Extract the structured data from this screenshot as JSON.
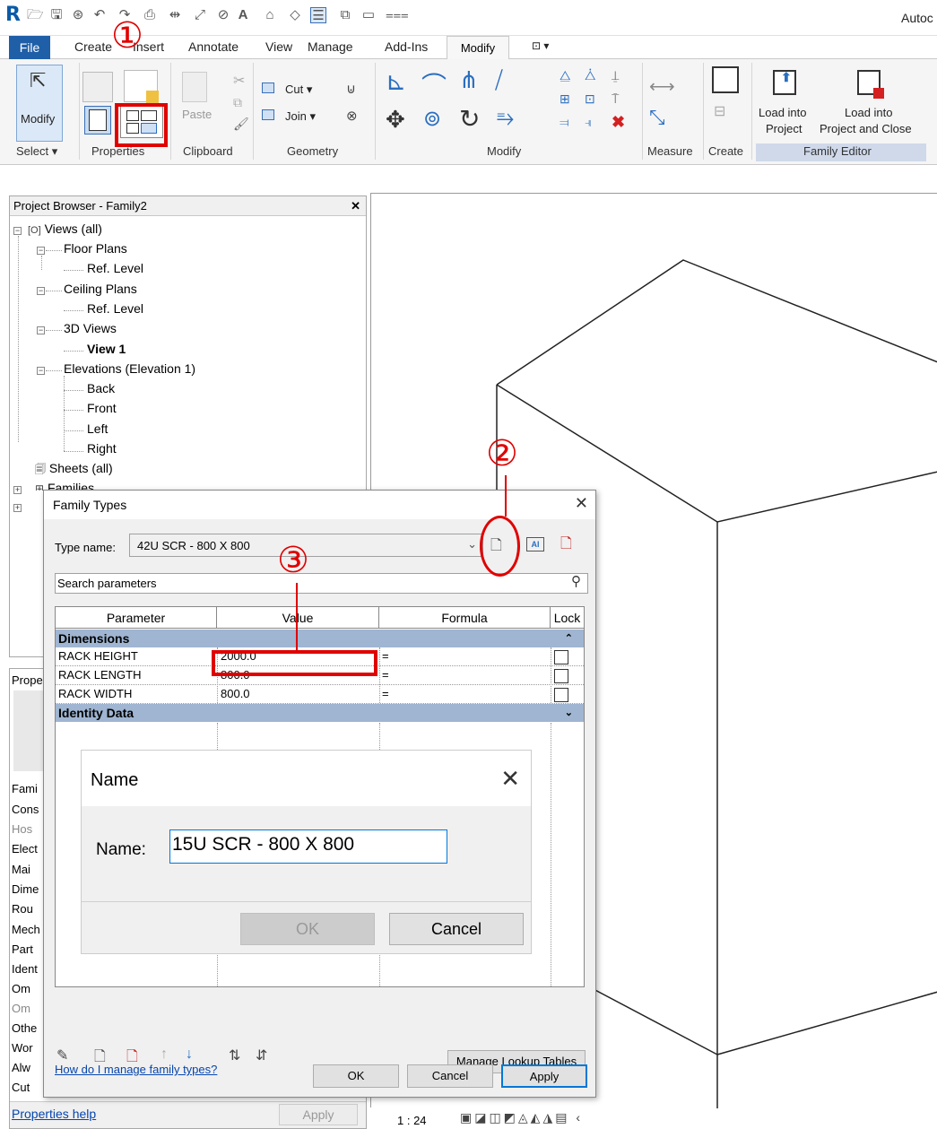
{
  "app": {
    "title": "Autoc"
  },
  "tabs": [
    {
      "label": "File"
    },
    {
      "label": "Create"
    },
    {
      "label": "Insert"
    },
    {
      "label": "Annotate"
    },
    {
      "label": "View"
    },
    {
      "label": "Manage"
    },
    {
      "label": "Add-Ins"
    },
    {
      "label": "Modify"
    },
    {
      "label": "⊡ ▾"
    }
  ],
  "ribbon": {
    "modify_label": "Modify",
    "paste_label": "Paste",
    "cut_label": "Cut ▾",
    "join_label": "Join ▾",
    "load_into_project_1": "Load into",
    "load_into_project_2": "Project",
    "load_close_1": "Load into",
    "load_close_2": "Project and Close",
    "panels": {
      "select": "Select ▾",
      "properties": "Properties",
      "clipboard": "Clipboard",
      "geometry": "Geometry",
      "modify": "Modify",
      "measure": "Measure",
      "create": "Create",
      "family_editor": "Family Editor"
    }
  },
  "project_browser": {
    "title": "Project Browser - Family2",
    "items": [
      {
        "label": "Views (all)"
      },
      {
        "label": "Floor Plans"
      },
      {
        "label": "Ref. Level"
      },
      {
        "label": "Ceiling Plans"
      },
      {
        "label": "Ref. Level"
      },
      {
        "label": "3D Views"
      },
      {
        "label": "View 1"
      },
      {
        "label": "Elevations (Elevation 1)"
      },
      {
        "label": "Back"
      },
      {
        "label": "Front"
      },
      {
        "label": "Left"
      },
      {
        "label": "Right"
      },
      {
        "label": "Sheets (all)"
      },
      {
        "label": "Families"
      }
    ]
  },
  "properties_palette": {
    "title": "Prope",
    "rows": [
      "Fami",
      "Cons",
      "Hos",
      "Elect",
      "Mai",
      "Dime",
      "Rou",
      "Mech",
      "Part",
      "Ident",
      "Om",
      "Om",
      "Othe",
      "Wor",
      "Alw",
      "Cut"
    ],
    "help_link": "Properties help",
    "apply": "Apply"
  },
  "family_types": {
    "title": "Family Types",
    "type_name_label": "Type name:",
    "type_name_value": "42U SCR - 800 X 800",
    "search_placeholder": "Search parameters",
    "columns": {
      "parameter": "Parameter",
      "value": "Value",
      "formula": "Formula",
      "lock": "Lock"
    },
    "sections": {
      "dimensions": "Dimensions",
      "identity": "Identity Data"
    },
    "rows": [
      {
        "param": "RACK HEIGHT",
        "value": "2000.0",
        "formula": "="
      },
      {
        "param": "RACK LENGTH",
        "value": "800.0",
        "formula": "="
      },
      {
        "param": "RACK WIDTH",
        "value": "800.0",
        "formula": "="
      }
    ],
    "manage_lookup": "Manage Lookup Tables",
    "help_link": "How do I manage family types?",
    "ok": "OK",
    "cancel": "Cancel",
    "apply": "Apply"
  },
  "name_dialog": {
    "title": "Name",
    "label": "Name:",
    "value": "15U SCR - 800 X 800",
    "ok": "OK",
    "cancel": "Cancel"
  },
  "status": {
    "scale": "1 : 24"
  },
  "annotations": {
    "step1": "①",
    "step2": "②",
    "step3": "③",
    "color": "#e00000"
  }
}
